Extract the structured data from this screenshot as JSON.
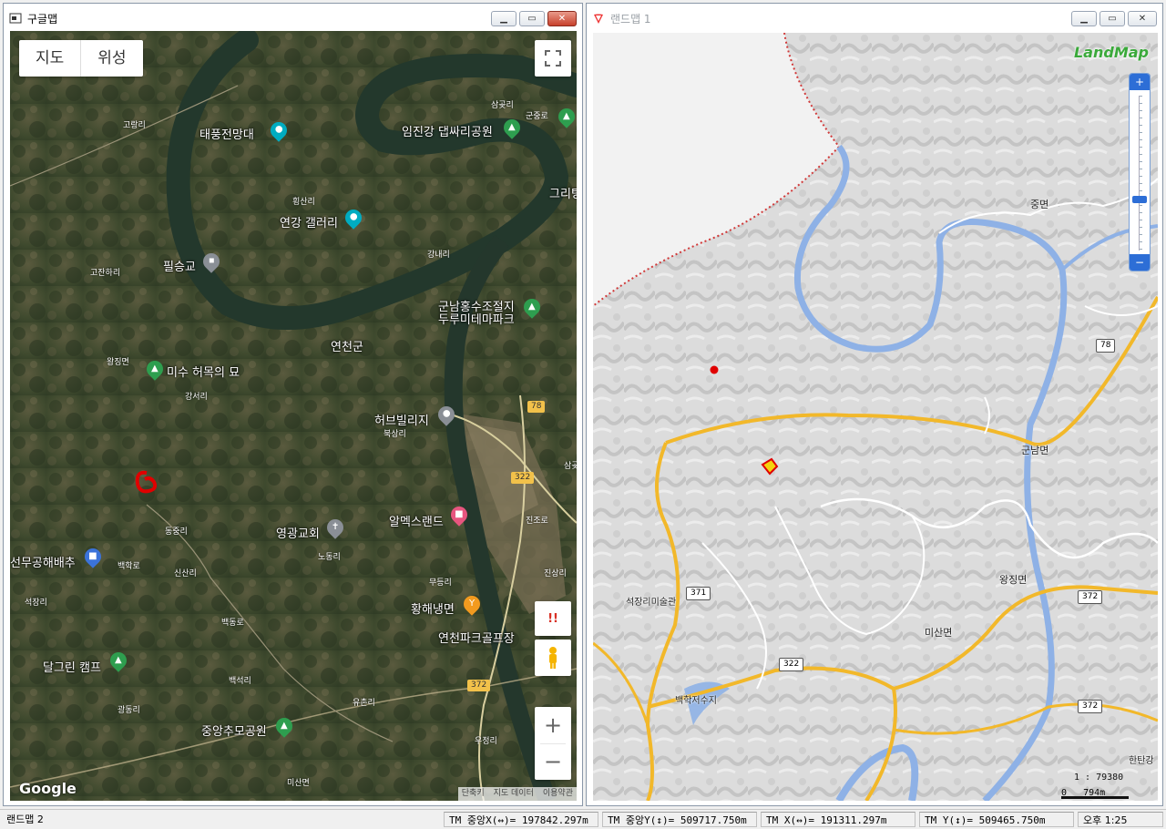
{
  "left_window": {
    "title": "구글맵",
    "map_type": [
      "지도",
      "위성"
    ],
    "places": {
      "taepung": "태풍전망대",
      "imjin": "임진강 댑싸리공원",
      "yeongang": "연강 갤러리",
      "pilseung": "필승교",
      "gunnam_1": "군남홍수조절지",
      "gunnam_2": "두루미테마파크",
      "yeoncheon": "연천군",
      "misu": "미수 허목의 묘",
      "herb": "허브빌리지",
      "alps": "알멕스랜드",
      "church": "영광교회",
      "seonmu": "선무공해배추",
      "hwanghae": "황해냉면",
      "golf": "연천파크골프장",
      "dalgreen": "달그린 캠프",
      "jungang": "중앙추모공원",
      "grill": "그리팅"
    },
    "small_labels": {
      "samgot": "삼곶리",
      "gunjung": "군중로",
      "gorang": "고랑리",
      "hoengsan": "횡산리",
      "gangnae": "강내리",
      "gojang": "고잔하리",
      "wangjing": "왕징면",
      "gangseo": "강서리",
      "buksang": "북상리",
      "dongjung": "동중리",
      "nodong": "노동리",
      "baekhak": "백학로",
      "sinsan": "신산리",
      "seoksan": "석장리",
      "baekdong": "백동로",
      "baekseok": "백석리",
      "yuchon": "유촌리",
      "gwangdong": "광동리",
      "ujeong": "우정리",
      "misan": "미산면",
      "mudeung": "무등리",
      "jinsang": "진상리",
      "jinjo": "진조로",
      "sam": "삼곶"
    },
    "route_shields": [
      "78",
      "322",
      "372"
    ],
    "buttons": {
      "zoom_in": "+",
      "zoom_out": "−",
      "report": "!!"
    },
    "attribution": [
      "단축키",
      "지도 데이터",
      "이용약관"
    ],
    "logo": "Google"
  },
  "right_window": {
    "title": "랜드맵 1",
    "logo": "LandMap",
    "towns": {
      "jung": "중면",
      "gunnam": "군남면",
      "wangjing": "왕징면",
      "misan": "미산면",
      "seokjang": "석장리미술관",
      "baekhak": "백학저수지",
      "hantan": "한탄강"
    },
    "route_shields": [
      "78",
      "371",
      "322",
      "372",
      "372"
    ],
    "scale_ratio": "1 : 79380",
    "scale_bar": "0   794m"
  },
  "status": {
    "title": "랜드맵 2",
    "tm_cx": "TM 중앙X(↔)= 197842.297m",
    "tm_cy": "TM 중앙Y(↕)= 509717.750m",
    "tm_x": "TM X(↔)= 191311.297m",
    "tm_y": "TM Y(↕)= 509465.750m",
    "time": "오후 1:25"
  },
  "colors": {
    "satellite_bg": "#3b4a2c",
    "river": "#2a3f2e",
    "landmap_bg": "#e4e4e4",
    "road_yellow": "#f2b82a",
    "river_blue": "#8eb1e6",
    "red_marker": "#e00000"
  }
}
